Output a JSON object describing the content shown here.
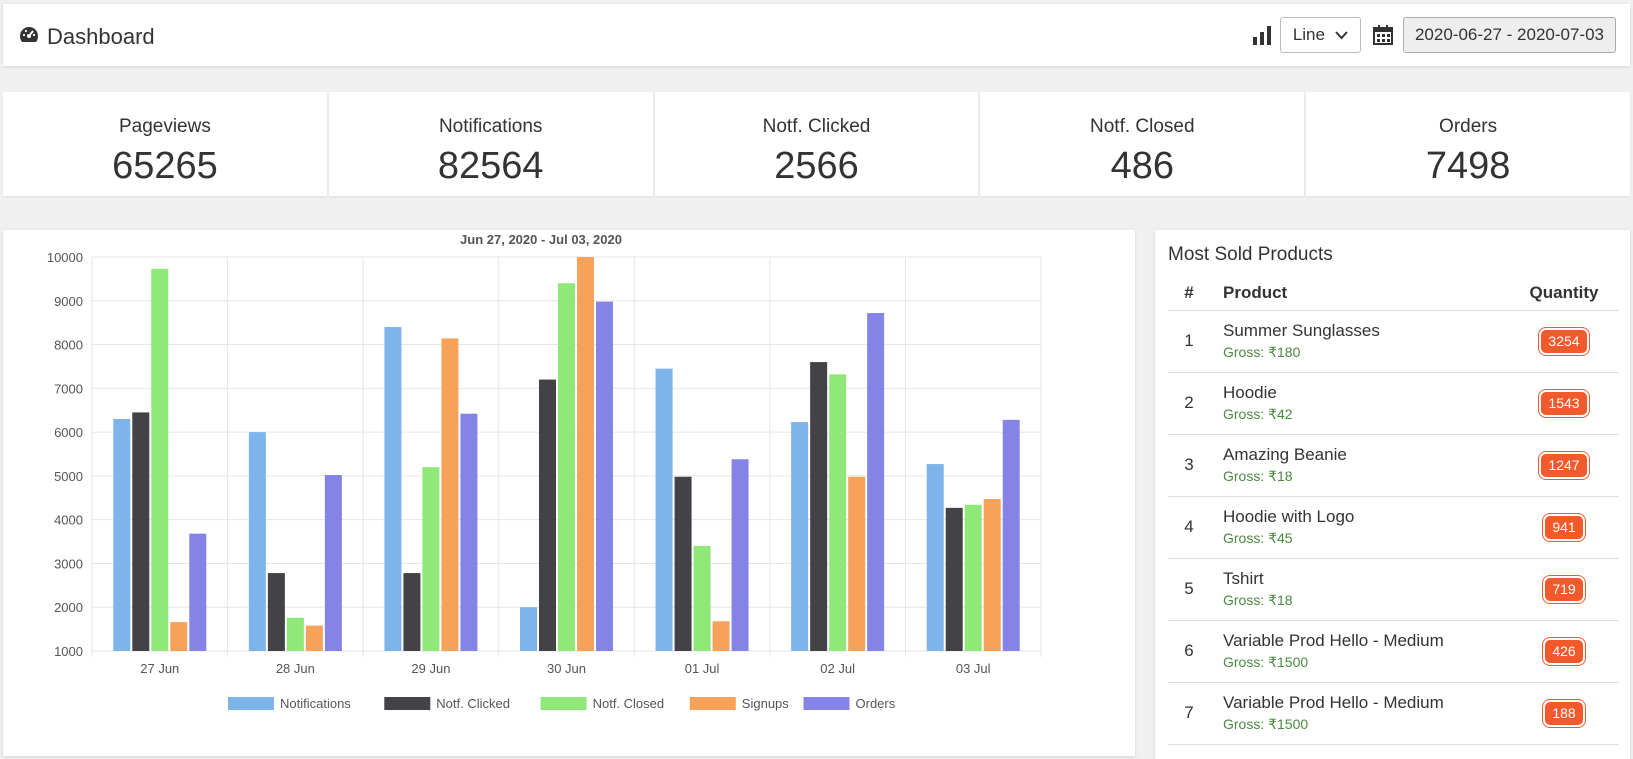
{
  "header": {
    "title": "Dashboard",
    "icon": "speedometer-icon",
    "chart_type_select": "Line",
    "date_range": "2020-06-27 - 2020-07-03"
  },
  "stats": [
    {
      "label": "Pageviews",
      "value": "65265"
    },
    {
      "label": "Notifications",
      "value": "82564"
    },
    {
      "label": "Notf. Clicked",
      "value": "2566"
    },
    {
      "label": "Notf. Closed",
      "value": "486"
    },
    {
      "label": "Orders",
      "value": "7498"
    }
  ],
  "chart_data": {
    "type": "bar",
    "title": "Jun 27, 2020 - Jul 03, 2020",
    "categories": [
      "27 Jun",
      "28 Jun",
      "29 Jun",
      "30 Jun",
      "01 Jul",
      "02 Jul",
      "03 Jul"
    ],
    "ylim": [
      1000,
      10000
    ],
    "yticks": [
      1000,
      2000,
      3000,
      4000,
      5000,
      6000,
      7000,
      8000,
      9000,
      10000
    ],
    "legend_position": "bottom",
    "grid": true,
    "series": [
      {
        "name": "Notifications",
        "color": "#7db4ea",
        "values": [
          6300,
          6000,
          8400,
          2000,
          7450,
          6230,
          5270
        ]
      },
      {
        "name": "Notf. Clicked",
        "color": "#424247",
        "values": [
          6450,
          2780,
          2780,
          7200,
          4980,
          7600,
          4270
        ]
      },
      {
        "name": "Notf. Closed",
        "color": "#8fe877",
        "values": [
          9730,
          1760,
          5200,
          9400,
          3400,
          7320,
          4340
        ]
      },
      {
        "name": "Signups",
        "color": "#f7a25a",
        "values": [
          1660,
          1580,
          8140,
          10000,
          1680,
          4980,
          4470
        ]
      },
      {
        "name": "Orders",
        "color": "#8384e6",
        "values": [
          3680,
          5020,
          6420,
          8980,
          5380,
          8720,
          6280
        ]
      }
    ]
  },
  "products": {
    "title": "Most Sold Products",
    "columns": [
      "#",
      "Product",
      "Quantity"
    ],
    "rows": [
      {
        "idx": "1",
        "name": "Summer Sunglasses",
        "gross": "Gross: ₹180",
        "qty": "3254"
      },
      {
        "idx": "2",
        "name": "Hoodie",
        "gross": "Gross: ₹42",
        "qty": "1543"
      },
      {
        "idx": "3",
        "name": "Amazing Beanie",
        "gross": "Gross: ₹18",
        "qty": "1247"
      },
      {
        "idx": "4",
        "name": "Hoodie with Logo",
        "gross": "Gross: ₹45",
        "qty": "941"
      },
      {
        "idx": "5",
        "name": "Tshirt",
        "gross": "Gross: ₹18",
        "qty": "719"
      },
      {
        "idx": "6",
        "name": "Variable Prod Hello - Medium",
        "gross": "Gross: ₹1500",
        "qty": "426"
      },
      {
        "idx": "7",
        "name": "Variable Prod Hello - Medium",
        "gross": "Gross: ₹1500",
        "qty": "188"
      }
    ]
  }
}
